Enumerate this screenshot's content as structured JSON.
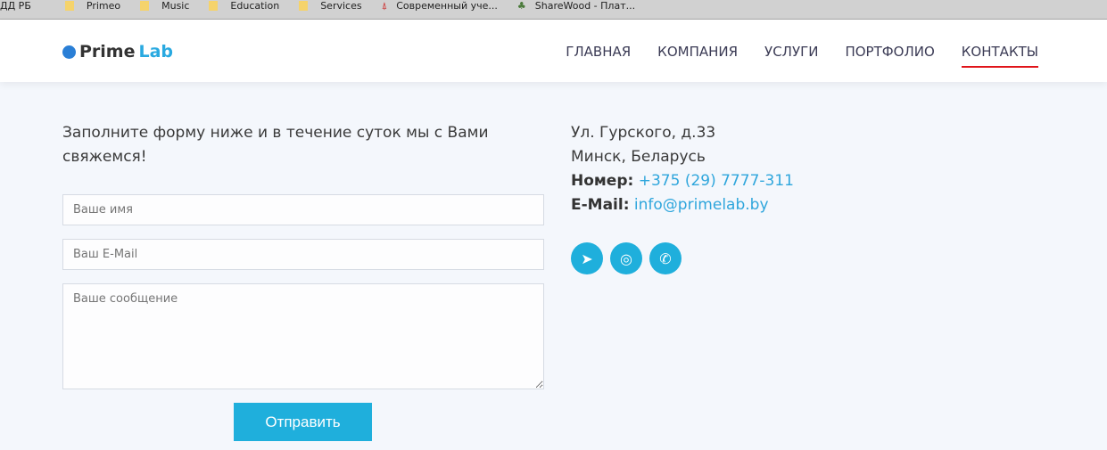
{
  "bookmarks": [
    "ДД РБ",
    "Primeo",
    "Music",
    "Education",
    "Services",
    "Современный уче...",
    "ShareWood - Плат..."
  ],
  "logo": {
    "part1": "Prime",
    "part2": "Lab"
  },
  "nav": [
    "ГЛАВНАЯ",
    "КОМПАНИЯ",
    "УСЛУГИ",
    "ПОРТФОЛИО",
    "КОНТАКТЫ"
  ],
  "form": {
    "intro": "Заполните форму ниже и в течение суток мы с Вами свяжемся!",
    "name_placeholder": "Ваше имя",
    "email_placeholder": "Ваш E-Mail",
    "message_placeholder": "Ваше сообщение",
    "submit": "Отправить"
  },
  "contact": {
    "address1": "Ул. Гурского, д.33",
    "address2": "Минск, Беларусь",
    "phone_label": "Номер:",
    "phone": "+375 (29) 7777-311",
    "email_label": "E-Mail:",
    "email": "info@primelab.by"
  }
}
